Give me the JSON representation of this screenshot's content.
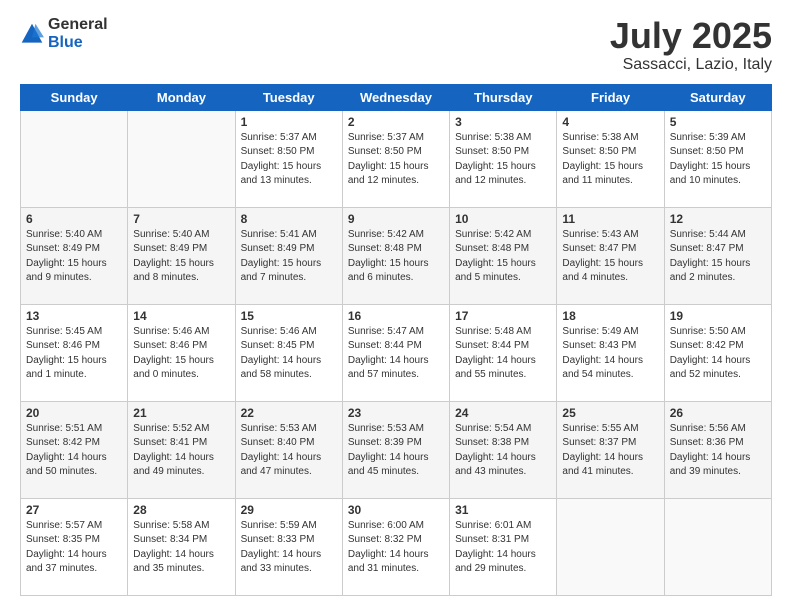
{
  "logo": {
    "general": "General",
    "blue": "Blue"
  },
  "title": "July 2025",
  "subtitle": "Sassacci, Lazio, Italy",
  "weekdays": [
    "Sunday",
    "Monday",
    "Tuesday",
    "Wednesday",
    "Thursday",
    "Friday",
    "Saturday"
  ],
  "weeks": [
    [
      {
        "day": "",
        "info": ""
      },
      {
        "day": "",
        "info": ""
      },
      {
        "day": "1",
        "info": "Sunrise: 5:37 AM\nSunset: 8:50 PM\nDaylight: 15 hours\nand 13 minutes."
      },
      {
        "day": "2",
        "info": "Sunrise: 5:37 AM\nSunset: 8:50 PM\nDaylight: 15 hours\nand 12 minutes."
      },
      {
        "day": "3",
        "info": "Sunrise: 5:38 AM\nSunset: 8:50 PM\nDaylight: 15 hours\nand 12 minutes."
      },
      {
        "day": "4",
        "info": "Sunrise: 5:38 AM\nSunset: 8:50 PM\nDaylight: 15 hours\nand 11 minutes."
      },
      {
        "day": "5",
        "info": "Sunrise: 5:39 AM\nSunset: 8:50 PM\nDaylight: 15 hours\nand 10 minutes."
      }
    ],
    [
      {
        "day": "6",
        "info": "Sunrise: 5:40 AM\nSunset: 8:49 PM\nDaylight: 15 hours\nand 9 minutes."
      },
      {
        "day": "7",
        "info": "Sunrise: 5:40 AM\nSunset: 8:49 PM\nDaylight: 15 hours\nand 8 minutes."
      },
      {
        "day": "8",
        "info": "Sunrise: 5:41 AM\nSunset: 8:49 PM\nDaylight: 15 hours\nand 7 minutes."
      },
      {
        "day": "9",
        "info": "Sunrise: 5:42 AM\nSunset: 8:48 PM\nDaylight: 15 hours\nand 6 minutes."
      },
      {
        "day": "10",
        "info": "Sunrise: 5:42 AM\nSunset: 8:48 PM\nDaylight: 15 hours\nand 5 minutes."
      },
      {
        "day": "11",
        "info": "Sunrise: 5:43 AM\nSunset: 8:47 PM\nDaylight: 15 hours\nand 4 minutes."
      },
      {
        "day": "12",
        "info": "Sunrise: 5:44 AM\nSunset: 8:47 PM\nDaylight: 15 hours\nand 2 minutes."
      }
    ],
    [
      {
        "day": "13",
        "info": "Sunrise: 5:45 AM\nSunset: 8:46 PM\nDaylight: 15 hours\nand 1 minute."
      },
      {
        "day": "14",
        "info": "Sunrise: 5:46 AM\nSunset: 8:46 PM\nDaylight: 15 hours\nand 0 minutes."
      },
      {
        "day": "15",
        "info": "Sunrise: 5:46 AM\nSunset: 8:45 PM\nDaylight: 14 hours\nand 58 minutes."
      },
      {
        "day": "16",
        "info": "Sunrise: 5:47 AM\nSunset: 8:44 PM\nDaylight: 14 hours\nand 57 minutes."
      },
      {
        "day": "17",
        "info": "Sunrise: 5:48 AM\nSunset: 8:44 PM\nDaylight: 14 hours\nand 55 minutes."
      },
      {
        "day": "18",
        "info": "Sunrise: 5:49 AM\nSunset: 8:43 PM\nDaylight: 14 hours\nand 54 minutes."
      },
      {
        "day": "19",
        "info": "Sunrise: 5:50 AM\nSunset: 8:42 PM\nDaylight: 14 hours\nand 52 minutes."
      }
    ],
    [
      {
        "day": "20",
        "info": "Sunrise: 5:51 AM\nSunset: 8:42 PM\nDaylight: 14 hours\nand 50 minutes."
      },
      {
        "day": "21",
        "info": "Sunrise: 5:52 AM\nSunset: 8:41 PM\nDaylight: 14 hours\nand 49 minutes."
      },
      {
        "day": "22",
        "info": "Sunrise: 5:53 AM\nSunset: 8:40 PM\nDaylight: 14 hours\nand 47 minutes."
      },
      {
        "day": "23",
        "info": "Sunrise: 5:53 AM\nSunset: 8:39 PM\nDaylight: 14 hours\nand 45 minutes."
      },
      {
        "day": "24",
        "info": "Sunrise: 5:54 AM\nSunset: 8:38 PM\nDaylight: 14 hours\nand 43 minutes."
      },
      {
        "day": "25",
        "info": "Sunrise: 5:55 AM\nSunset: 8:37 PM\nDaylight: 14 hours\nand 41 minutes."
      },
      {
        "day": "26",
        "info": "Sunrise: 5:56 AM\nSunset: 8:36 PM\nDaylight: 14 hours\nand 39 minutes."
      }
    ],
    [
      {
        "day": "27",
        "info": "Sunrise: 5:57 AM\nSunset: 8:35 PM\nDaylight: 14 hours\nand 37 minutes."
      },
      {
        "day": "28",
        "info": "Sunrise: 5:58 AM\nSunset: 8:34 PM\nDaylight: 14 hours\nand 35 minutes."
      },
      {
        "day": "29",
        "info": "Sunrise: 5:59 AM\nSunset: 8:33 PM\nDaylight: 14 hours\nand 33 minutes."
      },
      {
        "day": "30",
        "info": "Sunrise: 6:00 AM\nSunset: 8:32 PM\nDaylight: 14 hours\nand 31 minutes."
      },
      {
        "day": "31",
        "info": "Sunrise: 6:01 AM\nSunset: 8:31 PM\nDaylight: 14 hours\nand 29 minutes."
      },
      {
        "day": "",
        "info": ""
      },
      {
        "day": "",
        "info": ""
      }
    ]
  ]
}
